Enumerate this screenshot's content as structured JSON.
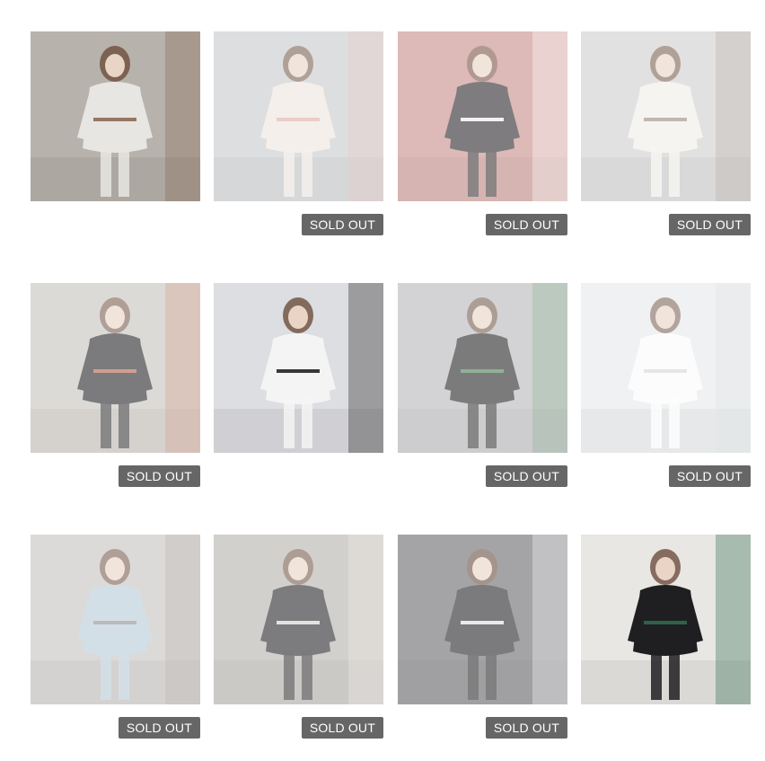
{
  "grid": {
    "status_color": "#666666",
    "items": [
      {
        "name": "product-white-blazer",
        "sold_out": false,
        "badge": "",
        "bg": "#b8b2ad",
        "figure": "#e8e6e2",
        "accent": "#8a6a55"
      },
      {
        "name": "product-floral-dress",
        "sold_out": true,
        "badge": "SOLD OUT",
        "bg": "#c9cacc",
        "figure": "#efe6df",
        "accent": "#d8a9a0"
      },
      {
        "name": "product-black-knit-dress",
        "sold_out": true,
        "badge": "SOLD OUT",
        "bg": "#c98f8b",
        "figure": "#2f2d30",
        "accent": "#ffffff"
      },
      {
        "name": "product-white-jacket-hat",
        "sold_out": true,
        "badge": "SOLD OUT",
        "bg": "#cfcfcf",
        "figure": "#f0eee8",
        "accent": "#8d7f74"
      },
      {
        "name": "product-black-blazer",
        "sold_out": true,
        "badge": "SOLD OUT",
        "bg": "#c7c3bd",
        "figure": "#2a2a2e",
        "accent": "#c4694c"
      },
      {
        "name": "product-white-tee-bag",
        "sold_out": false,
        "badge": "",
        "bg": "#dddee2",
        "figure": "#f4f4f4",
        "accent": "#222222"
      },
      {
        "name": "product-black-crop-top",
        "sold_out": true,
        "badge": "SOLD OUT",
        "bg": "#b9b8bb",
        "figure": "#2b2a2d",
        "accent": "#4f8a5a"
      },
      {
        "name": "product-white-joggers",
        "sold_out": true,
        "badge": "SOLD OUT",
        "bg": "#e6e8ea",
        "figure": "#fbfbfb",
        "accent": "#cfd3d6"
      },
      {
        "name": "product-ripped-jeans",
        "sold_out": true,
        "badge": "SOLD OUT",
        "bg": "#c6c3c0",
        "figure": "#b9cbd9",
        "accent": "#8f8a86"
      },
      {
        "name": "product-zip-dress",
        "sold_out": true,
        "badge": "SOLD OUT",
        "bg": "#b7b3ae",
        "figure": "#2c2b2f",
        "accent": "#e7e1db"
      },
      {
        "name": "product-reflective-hoodie",
        "sold_out": true,
        "badge": "SOLD OUT",
        "bg": "#6d6b70",
        "figure": "#2a292d",
        "accent": "#f2f2f2"
      },
      {
        "name": "product-flare-pants",
        "sold_out": false,
        "badge": "",
        "bg": "#e8e7e4",
        "figure": "#1f1f22",
        "accent": "#2f6a4c"
      }
    ]
  }
}
